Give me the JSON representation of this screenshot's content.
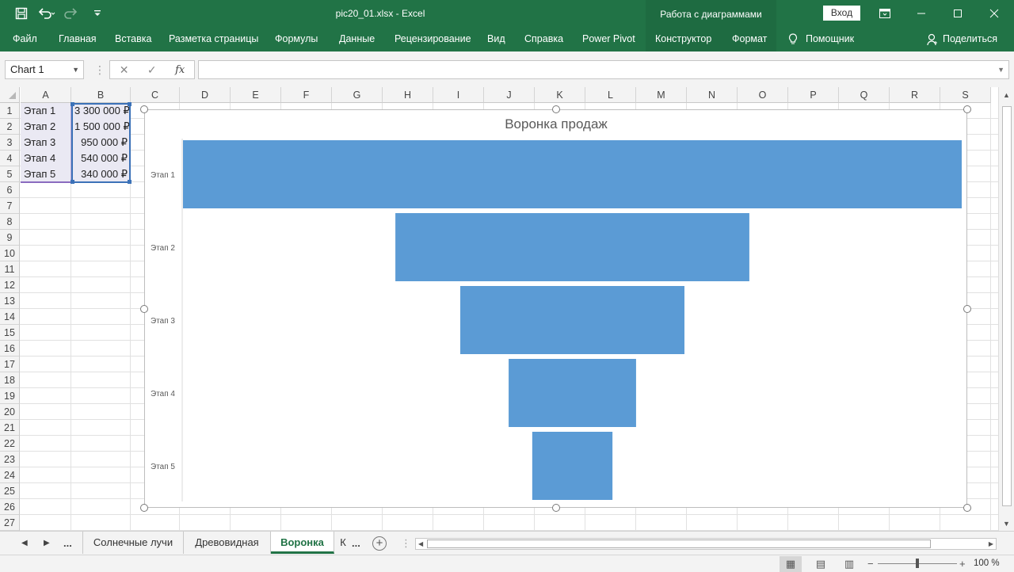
{
  "window": {
    "file_title": "pic20_01.xlsx  -  Excel",
    "contextual_group": "Работа с диаграммами",
    "sign_in": "Вход",
    "icons": [
      "save-icon",
      "undo-icon",
      "redo-icon",
      "customize-icon",
      "ribbon-display-icon",
      "minimize-icon",
      "maximize-icon",
      "close-icon"
    ]
  },
  "ribbon": {
    "tabs": [
      "Файл",
      "Главная",
      "Вставка",
      "Разметка страницы",
      "Формулы",
      "Данные",
      "Рецензирование",
      "Вид",
      "Справка",
      "Power Pivot",
      "Конструктор",
      "Формат"
    ],
    "help": "Помощник",
    "share": "Поделиться"
  },
  "formula_bar": {
    "name_box": "Chart 1",
    "fx": "fx",
    "value": ""
  },
  "grid": {
    "columns": [
      "A",
      "B",
      "C",
      "D",
      "E",
      "F",
      "G",
      "H",
      "I",
      "J",
      "K",
      "L",
      "M",
      "N",
      "O",
      "P",
      "Q",
      "R",
      "S"
    ],
    "rows": [
      "1",
      "2",
      "3",
      "4",
      "5",
      "6",
      "7",
      "8",
      "9",
      "10",
      "11",
      "12",
      "13",
      "14",
      "15",
      "16",
      "17",
      "18",
      "19",
      "20",
      "21",
      "22",
      "23",
      "24",
      "25",
      "26",
      "27"
    ],
    "cells": [
      {
        "a": "Этап 1",
        "b": "3 300 000 ₽"
      },
      {
        "a": "Этап 2",
        "b": "1 500 000 ₽"
      },
      {
        "a": "Этап 3",
        "b": "950 000 ₽"
      },
      {
        "a": "Этап 4",
        "b": "540 000 ₽"
      },
      {
        "a": "Этап 5",
        "b": "340 000 ₽"
      }
    ]
  },
  "chart_data": {
    "type": "bar",
    "subtype": "funnel",
    "title": "Воронка продаж",
    "categories": [
      "Этап 1",
      "Этап 2",
      "Этап 3",
      "Этап 4",
      "Этап 5"
    ],
    "values": [
      3300000,
      1500000,
      950000,
      540000,
      340000
    ],
    "bar_color": "#5b9bd5",
    "grid": false,
    "legend": "none"
  },
  "sheets": {
    "more_left": "...",
    "more_right": "...",
    "tabs": [
      "Солнечные лучи",
      "Древовидная",
      "Воронка",
      "К"
    ],
    "active": "Воронка"
  },
  "status": {
    "zoom_minus": "−",
    "zoom_plus": "+",
    "zoom": "100 %"
  },
  "colors": {
    "accent": "#217346",
    "chart_bar": "#5b9bd5"
  }
}
